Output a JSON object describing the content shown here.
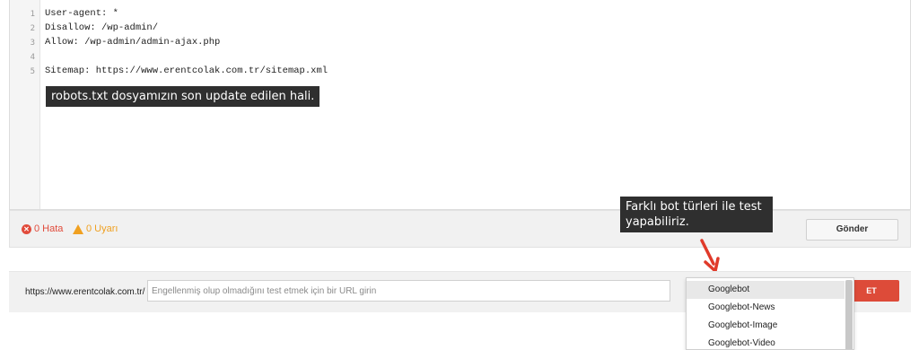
{
  "editor": {
    "lines": [
      {
        "num": "1",
        "text": "User-agent: *"
      },
      {
        "num": "2",
        "text": "Disallow: /wp-admin/"
      },
      {
        "num": "3",
        "text": "Allow: /wp-admin/admin-ajax.php"
      },
      {
        "num": "4",
        "text": ""
      },
      {
        "num": "5",
        "text": "Sitemap: https://www.erentcolak.com.tr/sitemap.xml"
      }
    ]
  },
  "annotations": {
    "editor_note": "robots.txt dosyamızın son update edilen hali.",
    "bot_note_line1": "Farklı bot türleri ile test",
    "bot_note_line2": "yapabiliriz."
  },
  "status": {
    "errors_label": "0 Hata",
    "warnings_label": "0 Uyarı",
    "submit_label": "Gönder",
    "error_color": "#e14b3b",
    "warning_color": "#f0a020"
  },
  "tester": {
    "url_prefix": "https://www.erentcolak.com.tr/",
    "input_placeholder": "Engellenmiş olup olmadığını test etmek için bir URL girin",
    "test_button_label": "ET",
    "test_button_color": "#dd4b39"
  },
  "bot_dropdown": {
    "selected": "Googlebot",
    "options": [
      "Googlebot",
      "Googlebot-News",
      "Googlebot-Image",
      "Googlebot-Video"
    ]
  }
}
